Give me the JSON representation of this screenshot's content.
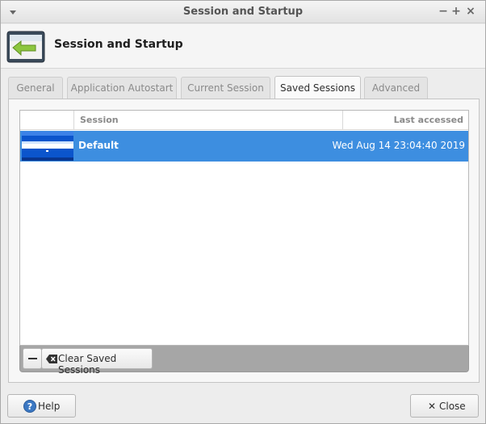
{
  "window": {
    "title": "Session and Startup",
    "controls": {
      "minimize": "−",
      "maximize": "+",
      "close": "×"
    }
  },
  "header": {
    "title": "Session and Startup",
    "icon": "session-startup-icon"
  },
  "tabs": [
    {
      "label": "General",
      "active": false
    },
    {
      "label": "Application Autostart",
      "active": false
    },
    {
      "label": "Current Session",
      "active": false
    },
    {
      "label": "Saved Sessions",
      "active": true
    },
    {
      "label": "Advanced",
      "active": false
    }
  ],
  "sessions_table": {
    "columns": [
      "Session",
      "Last accessed"
    ],
    "rows": [
      {
        "session": "Default",
        "last_accessed": "Wed Aug 14 23:04:40 2019",
        "selected": true
      }
    ]
  },
  "toolbar": {
    "clear_label": "Clear Saved Sessions"
  },
  "footer": {
    "help_label": "Help",
    "close_label": "Close"
  },
  "colors": {
    "selection": "#3d8ee0",
    "window_bg": "#ededed"
  }
}
